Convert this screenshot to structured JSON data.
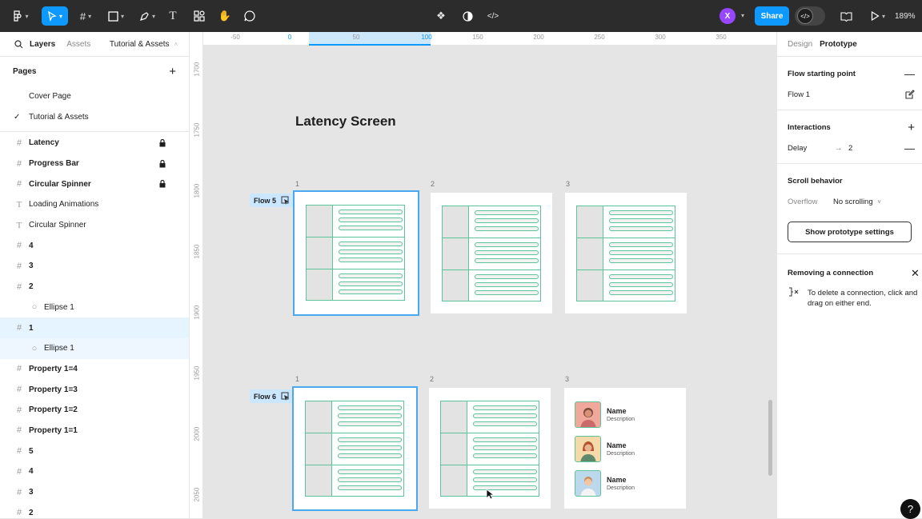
{
  "toolbar": {
    "share_label": "Share",
    "user_initial": "X",
    "zoom": "189%",
    "avatar_color": "#9747ff",
    "accent": "#0d99ff"
  },
  "left_panel": {
    "tabs": [
      "Layers",
      "Assets"
    ],
    "file_name": "Tutorial & Assets",
    "pages_title": "Pages",
    "pages": [
      {
        "label": "Cover Page",
        "current": false
      },
      {
        "label": "Tutorial & Assets",
        "current": true
      }
    ],
    "layers": [
      {
        "label": "Latency",
        "icon": "frame-icon",
        "bold": true,
        "locked": true
      },
      {
        "label": "Progress Bar",
        "icon": "frame-icon",
        "bold": true,
        "locked": true
      },
      {
        "label": "Circular Spinner",
        "icon": "frame-icon",
        "bold": true,
        "locked": true
      },
      {
        "label": "Loading Animations",
        "icon": "text-icon",
        "bold": false,
        "locked": false
      },
      {
        "label": "Circular Spinner",
        "icon": "text-icon",
        "bold": false,
        "locked": false
      },
      {
        "label": "4",
        "icon": "frame-icon",
        "bold": true,
        "locked": false
      },
      {
        "label": "3",
        "icon": "frame-icon",
        "bold": true,
        "locked": false
      },
      {
        "label": "2",
        "icon": "frame-icon",
        "bold": true,
        "locked": false
      },
      {
        "label": "Ellipse 1",
        "icon": "ellipse-icon",
        "bold": false,
        "locked": false,
        "child": true
      },
      {
        "label": "1",
        "icon": "frame-icon",
        "bold": true,
        "locked": false,
        "selected": true
      },
      {
        "label": "Ellipse 1",
        "icon": "ellipse-icon",
        "bold": false,
        "locked": false,
        "child": true,
        "selected_child": true
      },
      {
        "label": "Property 1=4",
        "icon": "frame-icon",
        "bold": true,
        "locked": false
      },
      {
        "label": "Property 1=3",
        "icon": "frame-icon",
        "bold": true,
        "locked": false
      },
      {
        "label": "Property 1=2",
        "icon": "frame-icon",
        "bold": true,
        "locked": false
      },
      {
        "label": "Property 1=1",
        "icon": "frame-icon",
        "bold": true,
        "locked": false
      },
      {
        "label": "5",
        "icon": "frame-icon",
        "bold": true,
        "locked": false
      },
      {
        "label": "4",
        "icon": "frame-icon",
        "bold": true,
        "locked": false
      },
      {
        "label": "3",
        "icon": "frame-icon",
        "bold": true,
        "locked": false
      },
      {
        "label": "2",
        "icon": "frame-icon",
        "bold": true,
        "locked": false
      }
    ]
  },
  "canvas": {
    "ruler_top": [
      "-50",
      "0",
      "50",
      "100",
      "150",
      "200",
      "250",
      "300",
      "350"
    ],
    "ruler_left": [
      "1700",
      "1750",
      "1800",
      "1850",
      "1900",
      "1950",
      "2000",
      "2050"
    ],
    "title": "Latency Screen",
    "frame_numbers": [
      "1",
      "2",
      "3"
    ],
    "flow5_label": "Flow 5",
    "flow6_label": "Flow 6",
    "cards": [
      {
        "name": "Name",
        "desc": "Description"
      },
      {
        "name": "Name",
        "desc": "Description"
      },
      {
        "name": "Name",
        "desc": "Description"
      }
    ],
    "wire_color": "#5cc49a"
  },
  "right_panel": {
    "tabs": [
      "Design",
      "Prototype"
    ],
    "flow_start_title": "Flow starting point",
    "flow_start_value": "Flow 1",
    "interactions_title": "Interactions",
    "interaction_trigger": "Delay",
    "interaction_value": "2",
    "scroll_title": "Scroll behavior",
    "overflow_label": "Overflow",
    "overflow_value": "No scrolling",
    "show_settings_label": "Show prototype settings",
    "remove_title": "Removing a connection",
    "remove_text": "To delete a connection, click and drag on either end."
  },
  "help_label": "?"
}
